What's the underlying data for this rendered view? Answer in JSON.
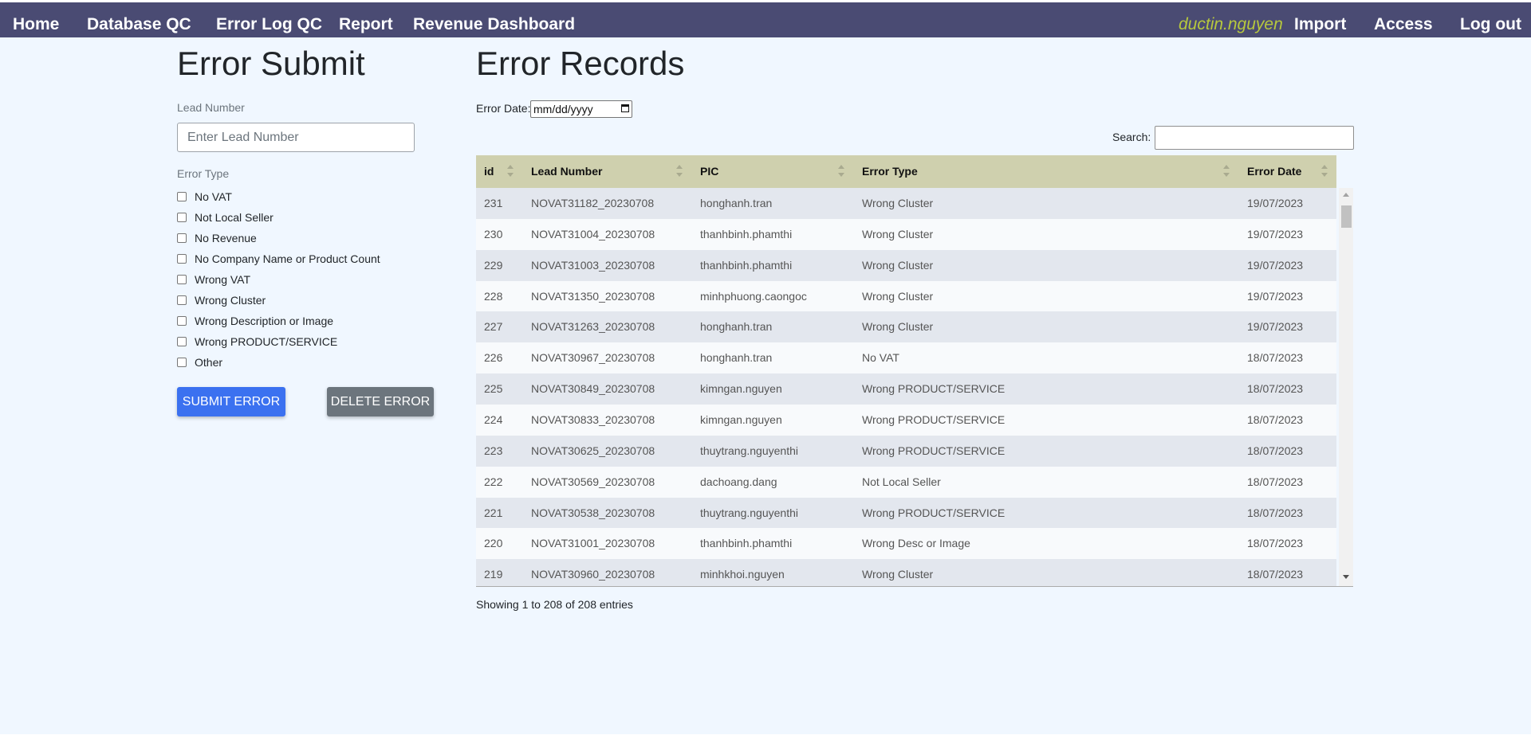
{
  "nav": {
    "left": [
      "Home",
      "Database QC",
      "Error Log QC",
      "Report",
      "Revenue Dashboard"
    ],
    "user": "ductin.nguyen",
    "right": [
      "Import",
      "Access",
      "Log out"
    ]
  },
  "submit": {
    "title": "Error Submit",
    "lead_label": "Lead Number",
    "lead_placeholder": "Enter Lead Number",
    "error_type_label": "Error Type",
    "error_types": [
      "No VAT",
      "Not Local Seller",
      "No Revenue",
      "No Company Name or Product Count",
      "Wrong VAT",
      "Wrong Cluster",
      "Wrong Description or Image",
      "Wrong PRODUCT/SERVICE",
      "Other"
    ],
    "submit_label": "SUBMIT ERROR",
    "delete_label": "DELETE ERROR"
  },
  "records": {
    "title": "Error Records",
    "date_label": "Error Date:",
    "date_placeholder": "mm/dd/yyyy",
    "search_label": "Search:",
    "columns": [
      "id",
      "Lead Number",
      "PIC",
      "Error Type",
      "Error Date"
    ],
    "rows": [
      [
        "231",
        "NOVAT31182_20230708",
        "honghanh.tran",
        "Wrong Cluster",
        "19/07/2023"
      ],
      [
        "230",
        "NOVAT31004_20230708",
        "thanhbinh.phamthi",
        "Wrong Cluster",
        "19/07/2023"
      ],
      [
        "229",
        "NOVAT31003_20230708",
        "thanhbinh.phamthi",
        "Wrong Cluster",
        "19/07/2023"
      ],
      [
        "228",
        "NOVAT31350_20230708",
        "minhphuong.caongoc",
        "Wrong Cluster",
        "19/07/2023"
      ],
      [
        "227",
        "NOVAT31263_20230708",
        "honghanh.tran",
        "Wrong Cluster",
        "19/07/2023"
      ],
      [
        "226",
        "NOVAT30967_20230708",
        "honghanh.tran",
        "No VAT",
        "18/07/2023"
      ],
      [
        "225",
        "NOVAT30849_20230708",
        "kimngan.nguyen",
        "Wrong PRODUCT/SERVICE",
        "18/07/2023"
      ],
      [
        "224",
        "NOVAT30833_20230708",
        "kimngan.nguyen",
        "Wrong PRODUCT/SERVICE",
        "18/07/2023"
      ],
      [
        "223",
        "NOVAT30625_20230708",
        "thuytrang.nguyenthi",
        "Wrong PRODUCT/SERVICE",
        "18/07/2023"
      ],
      [
        "222",
        "NOVAT30569_20230708",
        "dachoang.dang",
        "Not Local Seller",
        "18/07/2023"
      ],
      [
        "221",
        "NOVAT30538_20230708",
        "thuytrang.nguyenthi",
        "Wrong PRODUCT/SERVICE",
        "18/07/2023"
      ],
      [
        "220",
        "NOVAT31001_20230708",
        "thanhbinh.phamthi",
        "Wrong Desc or Image",
        "18/07/2023"
      ],
      [
        "219",
        "NOVAT30960_20230708",
        "minhkhoi.nguyen",
        "Wrong Cluster",
        "18/07/2023"
      ]
    ],
    "info": "Showing 1 to 208 of 208 entries"
  }
}
